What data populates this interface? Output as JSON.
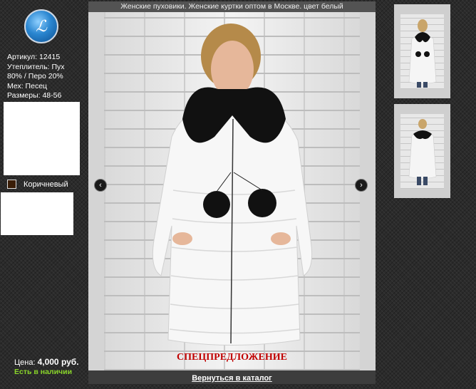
{
  "header": {
    "title": "Женские пуховики. Женские куртки оптом в Москве. цвет белый"
  },
  "logo": {
    "glyph": "ℒ"
  },
  "product": {
    "article": "Артикул: 12415",
    "insulation_line1": "Утеплитель: Пух",
    "insulation_line2": "80% / Перо 20%",
    "fur": "Мех: Песец",
    "sizes": "Размеры: 48-56"
  },
  "color_option": {
    "label": "Коричневый",
    "swatch": "#3a1d07"
  },
  "price": {
    "label": "Цена:",
    "value": "4,000 руб."
  },
  "stock": "Есть в наличии",
  "promo": "СПЕЦПРЕДЛОЖЕНИЕ",
  "nav": {
    "prev": "‹",
    "next": "›"
  },
  "back_link": "Вернуться в каталог"
}
